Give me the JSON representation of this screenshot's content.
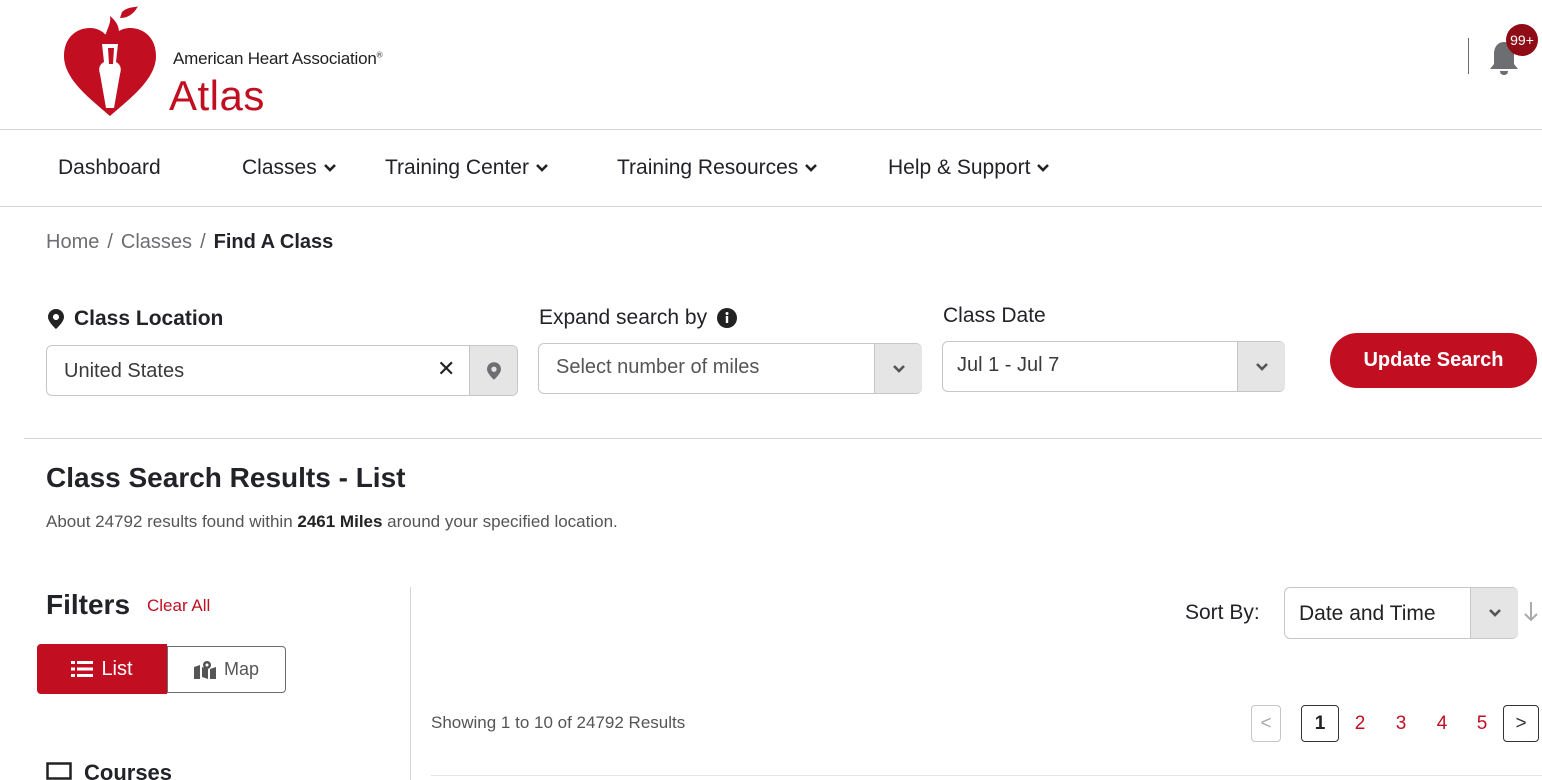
{
  "header": {
    "org_name": "American Heart Association",
    "registered_mark": "®",
    "app_name": "Atlas",
    "notification_count": "99+"
  },
  "nav": {
    "items": [
      {
        "label": "Dashboard",
        "has_dropdown": false
      },
      {
        "label": "Classes",
        "has_dropdown": true
      },
      {
        "label": "Training Center",
        "has_dropdown": true
      },
      {
        "label": "Training Resources",
        "has_dropdown": true
      },
      {
        "label": "Help & Support",
        "has_dropdown": true
      }
    ]
  },
  "breadcrumb": {
    "home": "Home",
    "separator": "/",
    "classes": "Classes",
    "current": "Find A Class"
  },
  "search": {
    "location_label": "Class Location",
    "location_value": "United States",
    "expand_label": "Expand search by",
    "expand_placeholder": "Select number of miles",
    "date_label": "Class Date",
    "date_value": "Jul 1 - Jul 7",
    "update_button": "Update Search"
  },
  "results": {
    "title": "Class Search Results - List",
    "summary_prefix": "About 24792 results found within ",
    "summary_distance": "2461 Miles",
    "summary_suffix": " around your specified location.",
    "showing": "Showing 1 to 10 of 24792 Results"
  },
  "filters": {
    "title": "Filters",
    "clear_all": "Clear All",
    "view_list": "List",
    "view_map": "Map",
    "courses_heading": "Courses"
  },
  "sort": {
    "label": "Sort By:",
    "value": "Date and Time"
  },
  "pagination": {
    "prev": "<",
    "pages": [
      "1",
      "2",
      "3",
      "4",
      "5"
    ],
    "current_page": "1",
    "next": ">"
  },
  "colors": {
    "brand_red": "#c10e21",
    "badge_red": "#8f0b16",
    "text_dark": "#222328",
    "border_gray": "#c6c6c6"
  },
  "icons": {
    "logo": "aha-heart-torch-logo",
    "notification": "bell-icon",
    "location": "map-marker-icon",
    "info": "info-circle-icon",
    "clear": "close-icon",
    "dropdown": "chevron-down-icon",
    "list": "list-icon",
    "map": "map-icon",
    "courses": "monitor-icon",
    "sort_direction": "arrow-down-icon"
  }
}
